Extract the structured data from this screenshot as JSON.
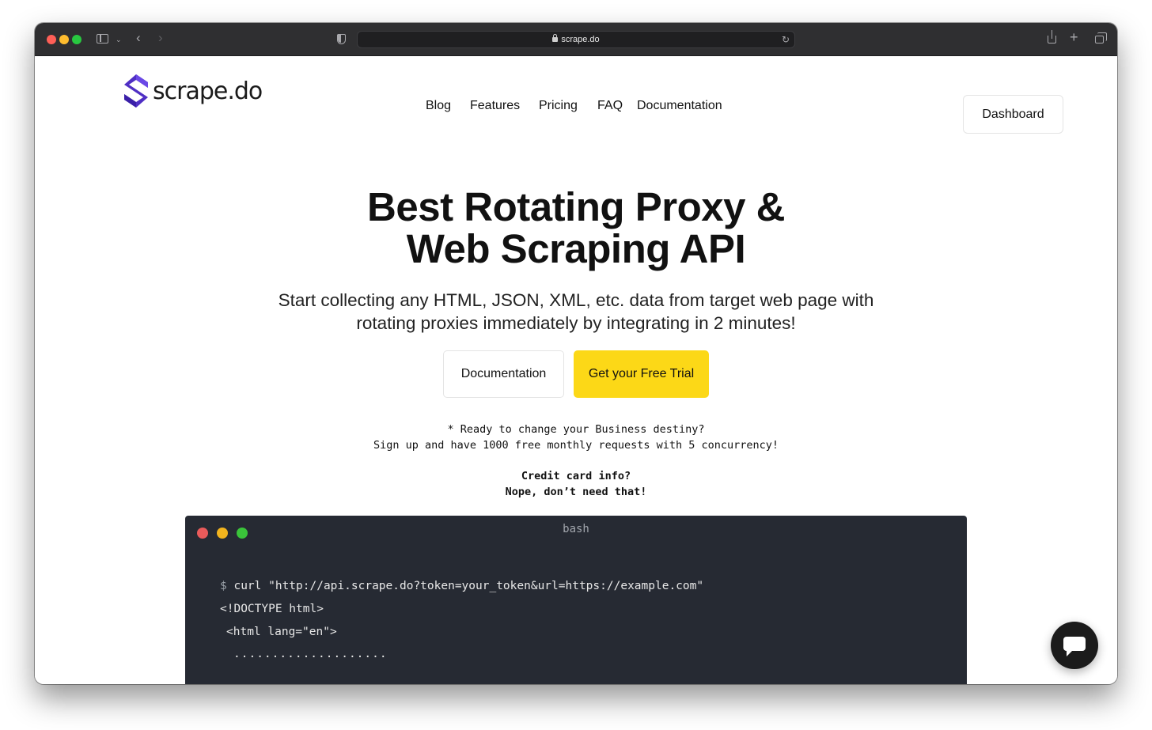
{
  "browser": {
    "url": "scrape.do",
    "icons": [
      "sidebar-icon",
      "chevron-down-icon",
      "back-icon",
      "forward-icon",
      "shield-icon",
      "lock-icon",
      "reload-icon",
      "share-icon",
      "new-tab-icon",
      "tabs-overview-icon"
    ]
  },
  "header": {
    "logo_text": "scrape.do",
    "nav": [
      "Blog",
      "Features",
      "Pricing",
      "FAQ",
      "Documentation"
    ],
    "dashboard_label": "Dashboard"
  },
  "hero": {
    "title_line1": "Best Rotating Proxy &",
    "title_line2": "Web Scraping API",
    "subtitle_line1": "Start collecting any HTML, JSON, XML, etc. data from target web page with",
    "subtitle_line2": "rotating proxies immediately by integrating in 2 minutes!",
    "doc_button": "Documentation",
    "trial_button": "Get your Free Trial",
    "note_line1": "* Ready to change your Business destiny?",
    "note_line2": "Sign up and have 1000 free monthly requests with 5 concurrency!",
    "cc_line1": "Credit card info?",
    "cc_line2": "Nope, don’t need that!"
  },
  "terminal": {
    "title": "bash",
    "prompt": "$",
    "command": "curl \"http://api.scrape.do?token=your_token&url=https://example.com\"",
    "line2": "<!DOCTYPE html>",
    "line3": "<html lang=\"en\">",
    "line4": "...................."
  },
  "colors": {
    "brand": "#4f2fc4",
    "cta": "#fcd817",
    "terminal_bg": "#262a33"
  },
  "chat": {
    "icon": "chat-icon"
  }
}
